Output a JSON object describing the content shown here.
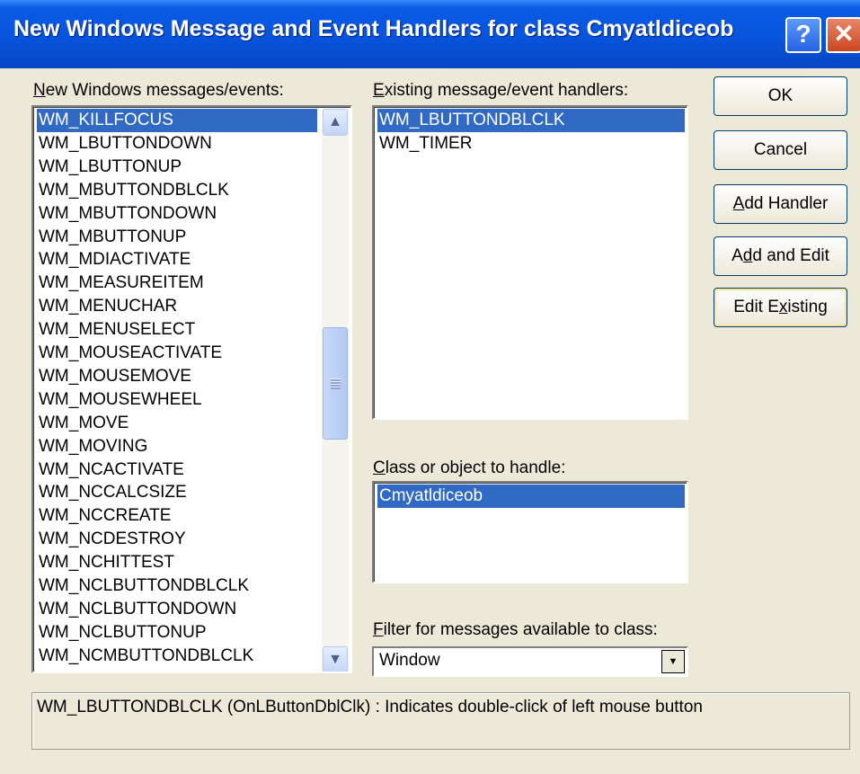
{
  "window": {
    "title": "New Windows Message and Event Handlers for class Cmyatldiceob"
  },
  "title_buttons": {
    "help": "?",
    "close": "✕"
  },
  "messages": {
    "label_hotkey": "N",
    "label_rest": "ew Windows messages/events:",
    "items": [
      "WM_KILLFOCUS",
      "WM_LBUTTONDOWN",
      "WM_LBUTTONUP",
      "WM_MBUTTONDBLCLK",
      "WM_MBUTTONDOWN",
      "WM_MBUTTONUP",
      "WM_MDIACTIVATE",
      "WM_MEASUREITEM",
      "WM_MENUCHAR",
      "WM_MENUSELECT",
      "WM_MOUSEACTIVATE",
      "WM_MOUSEMOVE",
      "WM_MOUSEWHEEL",
      "WM_MOVE",
      "WM_MOVING",
      "WM_NCACTIVATE",
      "WM_NCCALCSIZE",
      "WM_NCCREATE",
      "WM_NCDESTROY",
      "WM_NCHITTEST",
      "WM_NCLBUTTONDBLCLK",
      "WM_NCLBUTTONDOWN",
      "WM_NCLBUTTONUP",
      "WM_NCMBUTTONDBLCLK"
    ],
    "selected_index": 0
  },
  "existing": {
    "label_hotkey": "E",
    "label_rest": "xisting message/event handlers:",
    "items": [
      "WM_LBUTTONDBLCLK",
      "WM_TIMER"
    ],
    "selected_index": 0
  },
  "class_object": {
    "label_hotkey": "C",
    "label_rest": "lass or object to handle:",
    "items": [
      "Cmyatldiceob"
    ],
    "selected_index": 0
  },
  "filter": {
    "label_hotkey": "F",
    "label_rest": "ilter for messages available to class:",
    "value": "Window"
  },
  "buttons": {
    "ok": "OK",
    "cancel": "Cancel",
    "add_handler_hotkey": "A",
    "add_handler_rest": "dd Handler",
    "add_edit_pre": "A",
    "add_edit_hotkey": "d",
    "add_edit_rest": "d and Edit",
    "edit_existing_pre": "Edit E",
    "edit_existing_hotkey": "x",
    "edit_existing_rest": "isting"
  },
  "description": "WM_LBUTTONDBLCLK (OnLButtonDblClk) : Indicates double-click of left mouse button"
}
